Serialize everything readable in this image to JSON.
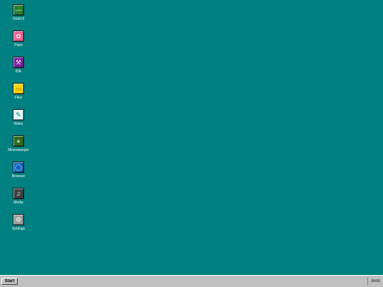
{
  "desktop": {
    "background_color": "#008080",
    "icons": [
      {
        "label": "OrbitV2",
        "icon": "terminal-icon",
        "color": "#2e7d32",
        "glyph": "—"
      },
      {
        "label": "Paint",
        "icon": "palette-icon",
        "color": "#f06292",
        "glyph": "✿"
      },
      {
        "label": "IDE",
        "icon": "tools-icon",
        "color": "#7b1fa2",
        "glyph": "⚒"
      },
      {
        "label": "Files",
        "icon": "folder-icon",
        "color": "#ffd600",
        "glyph": "▭"
      },
      {
        "label": "Notes",
        "icon": "notepad-icon",
        "color": "#e0f7fa",
        "glyph": "✎"
      },
      {
        "label": "Minesweeper",
        "icon": "mine-icon",
        "color": "#33691e",
        "glyph": "●"
      },
      {
        "label": "Browser",
        "icon": "globe-icon",
        "color": "#1565c0",
        "glyph": "◯"
      },
      {
        "label": "Media",
        "icon": "music-icon",
        "color": "#424242",
        "glyph": "♫"
      },
      {
        "label": "Settings",
        "icon": "gear-icon",
        "color": "#9e9e9e",
        "glyph": "⚙"
      }
    ]
  },
  "taskbar": {
    "start_label": "Start",
    "clock": "04:50"
  }
}
